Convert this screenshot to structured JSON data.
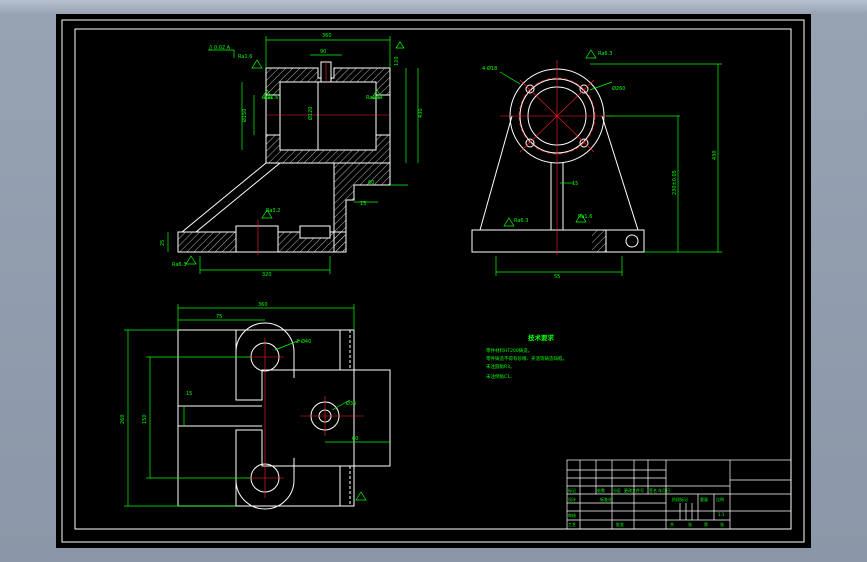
{
  "colors": {
    "viewport": "#8e9aab",
    "paper": "#000000",
    "outline": "#ffffff",
    "dimension": "#00ff00",
    "centerline": "#ff2020",
    "text": "#ffffff",
    "hatch": "#ffffff"
  },
  "dims": {
    "front": {
      "top_width": "360",
      "boss_width": "90",
      "height_overall": "430",
      "height_right": "120",
      "bore": "Ø120",
      "bore_left": "Ø150",
      "rib_thk": "60",
      "wall_thk": "15",
      "base_len": "320",
      "base_thk": "25",
      "rough_1": "Ra1.6",
      "rough_2": "Ra1.6",
      "rough_3": "Ra1.6",
      "rough_4": "Ra3.2",
      "rough_5": "Ra6.3",
      "tolerance_frame": "// 0.02 A"
    },
    "side": {
      "holes": "4-Ø18",
      "flange": "Ø260",
      "height_total": "430",
      "center_height": "230±0.05",
      "web": "15",
      "base_len": "55",
      "rough_top": "Ra6.3",
      "rough_left": "Ra6.3",
      "rough_right": "Ra1.6"
    },
    "top": {
      "overall_len": "360",
      "left_off": "75",
      "overall_h": "260",
      "inner_h": "150",
      "slot_w": "15",
      "hole_big": "2-Ø40",
      "hole_small": "Ø35",
      "span": "60"
    }
  },
  "notes": {
    "title": "技术要求",
    "lines": [
      "零件材料HT200铸造。",
      "零件铸造不得有砂眼、夹渣等铸造缺陷。",
      "未注圆角R3。",
      "未注倒角C1。"
    ]
  },
  "title_block": {
    "labels": {
      "mark": "标记",
      "count": "处数",
      "zone": "分区",
      "docno": "更改文件号",
      "sign": "签名",
      "date": "年月日",
      "design": "设计",
      "check": "审核",
      "process": "工艺",
      "approve": "批准",
      "stage": "阶段标记",
      "weight": "重量",
      "scale": "比例",
      "scale_val": "1:1",
      "total": "共",
      "sheet": "张",
      "no": "第",
      "std": "标准化"
    }
  }
}
